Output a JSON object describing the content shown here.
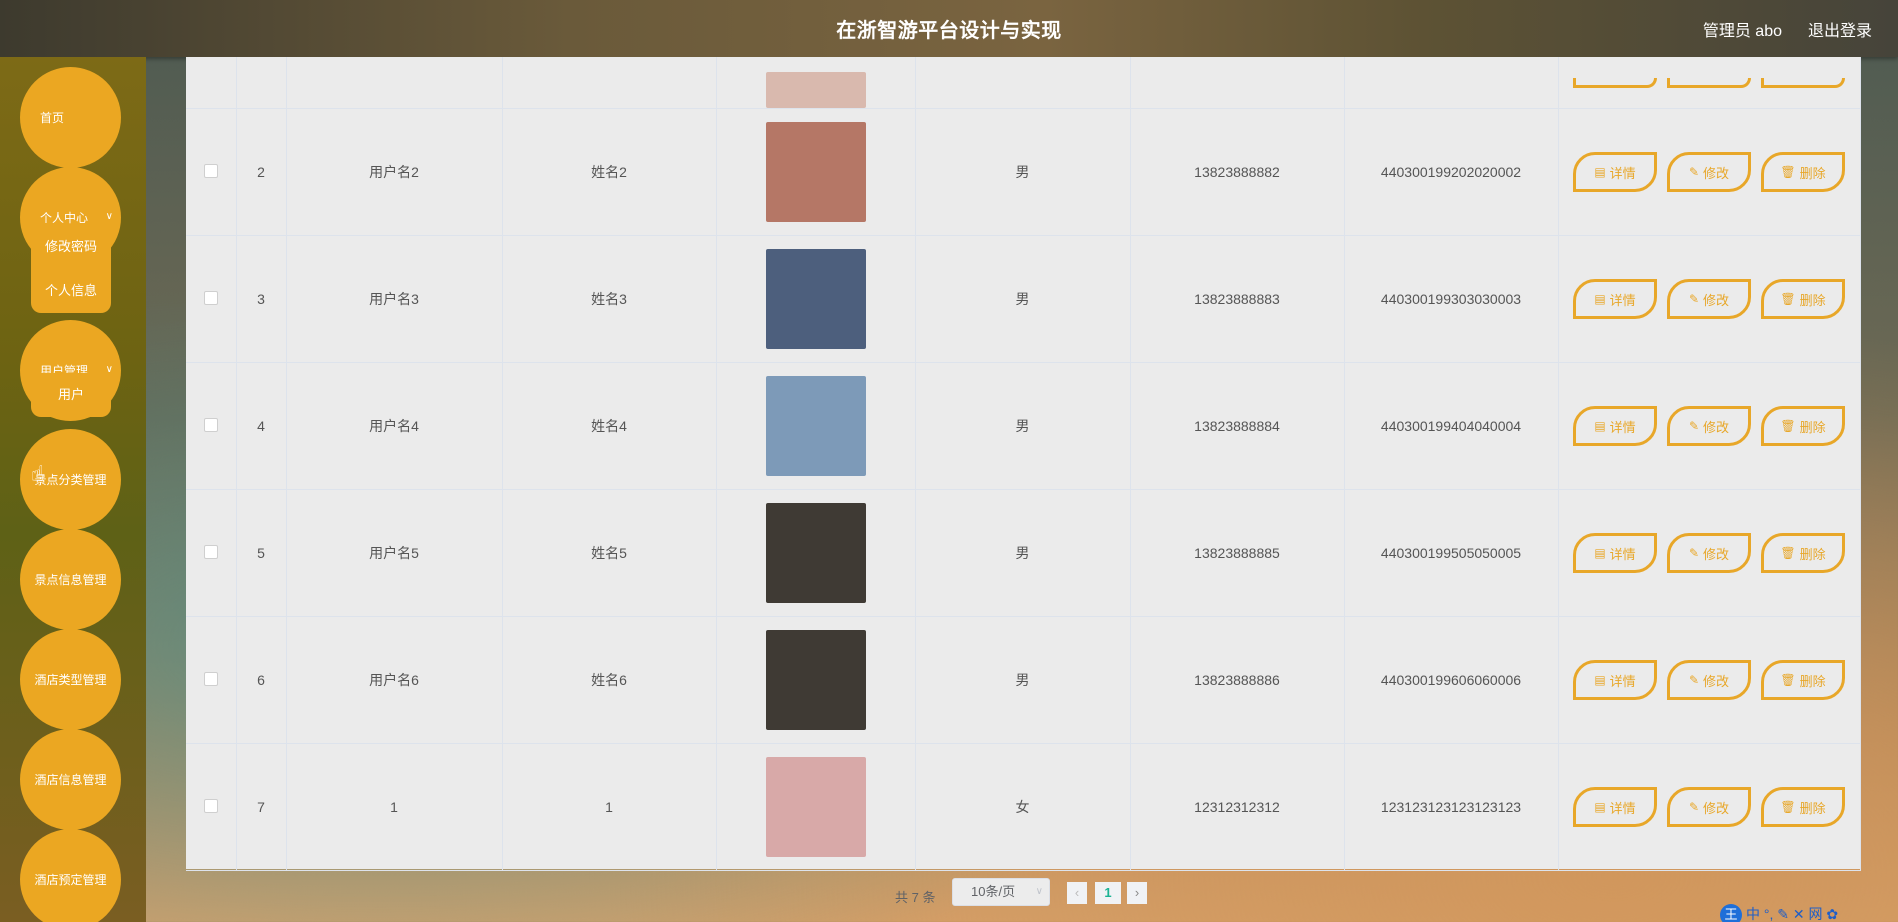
{
  "header": {
    "title": "在浙智游平台设计与实现",
    "admin": "管理员 abo",
    "logout": "退出登录"
  },
  "sidebar": {
    "home": "首页",
    "personal_center": "个人中心",
    "change_password": "修改密码",
    "personal_info": "个人信息",
    "user_management": "用户管理",
    "user": "用户",
    "scenic_category_mgmt": "景点分类管理",
    "scenic_info_mgmt": "景点信息管理",
    "hotel_type_mgmt": "酒店类型管理",
    "hotel_info_mgmt": "酒店信息管理",
    "hotel_booking_mgmt": "酒店预定管理"
  },
  "actions": {
    "detail": "详情",
    "edit": "修改",
    "delete": "删除"
  },
  "rows": [
    {
      "index": "2",
      "username": "用户名2",
      "name": "姓名2",
      "gender": "男",
      "phone": "13823888882",
      "id_number": "440300199202020002",
      "photo_color": "#b57766"
    },
    {
      "index": "3",
      "username": "用户名3",
      "name": "姓名3",
      "gender": "男",
      "phone": "13823888883",
      "id_number": "440300199303030003",
      "photo_color": "#4d5f7d"
    },
    {
      "index": "4",
      "username": "用户名4",
      "name": "姓名4",
      "gender": "男",
      "phone": "13823888884",
      "id_number": "440300199404040004",
      "photo_color": "#7d9ab8"
    },
    {
      "index": "5",
      "username": "用户名5",
      "name": "姓名5",
      "gender": "男",
      "phone": "13823888885",
      "id_number": "440300199505050005",
      "photo_color": "#3f3a34"
    },
    {
      "index": "6",
      "username": "用户名6",
      "name": "姓名6",
      "gender": "男",
      "phone": "13823888886",
      "id_number": "440300199606060006",
      "photo_color": "#3f3a34"
    },
    {
      "index": "7",
      "username": "1",
      "name": "1",
      "gender": "女",
      "phone": "12312312312",
      "id_number": "123123123123123123",
      "photo_color": "#d8a9a8"
    }
  ],
  "pagination": {
    "total": "共 7 条",
    "page_size": "10条/页",
    "current_page": "1"
  },
  "ime": {
    "logo": "王",
    "text": "中 °, ✎ ✕ 网 ✿"
  }
}
